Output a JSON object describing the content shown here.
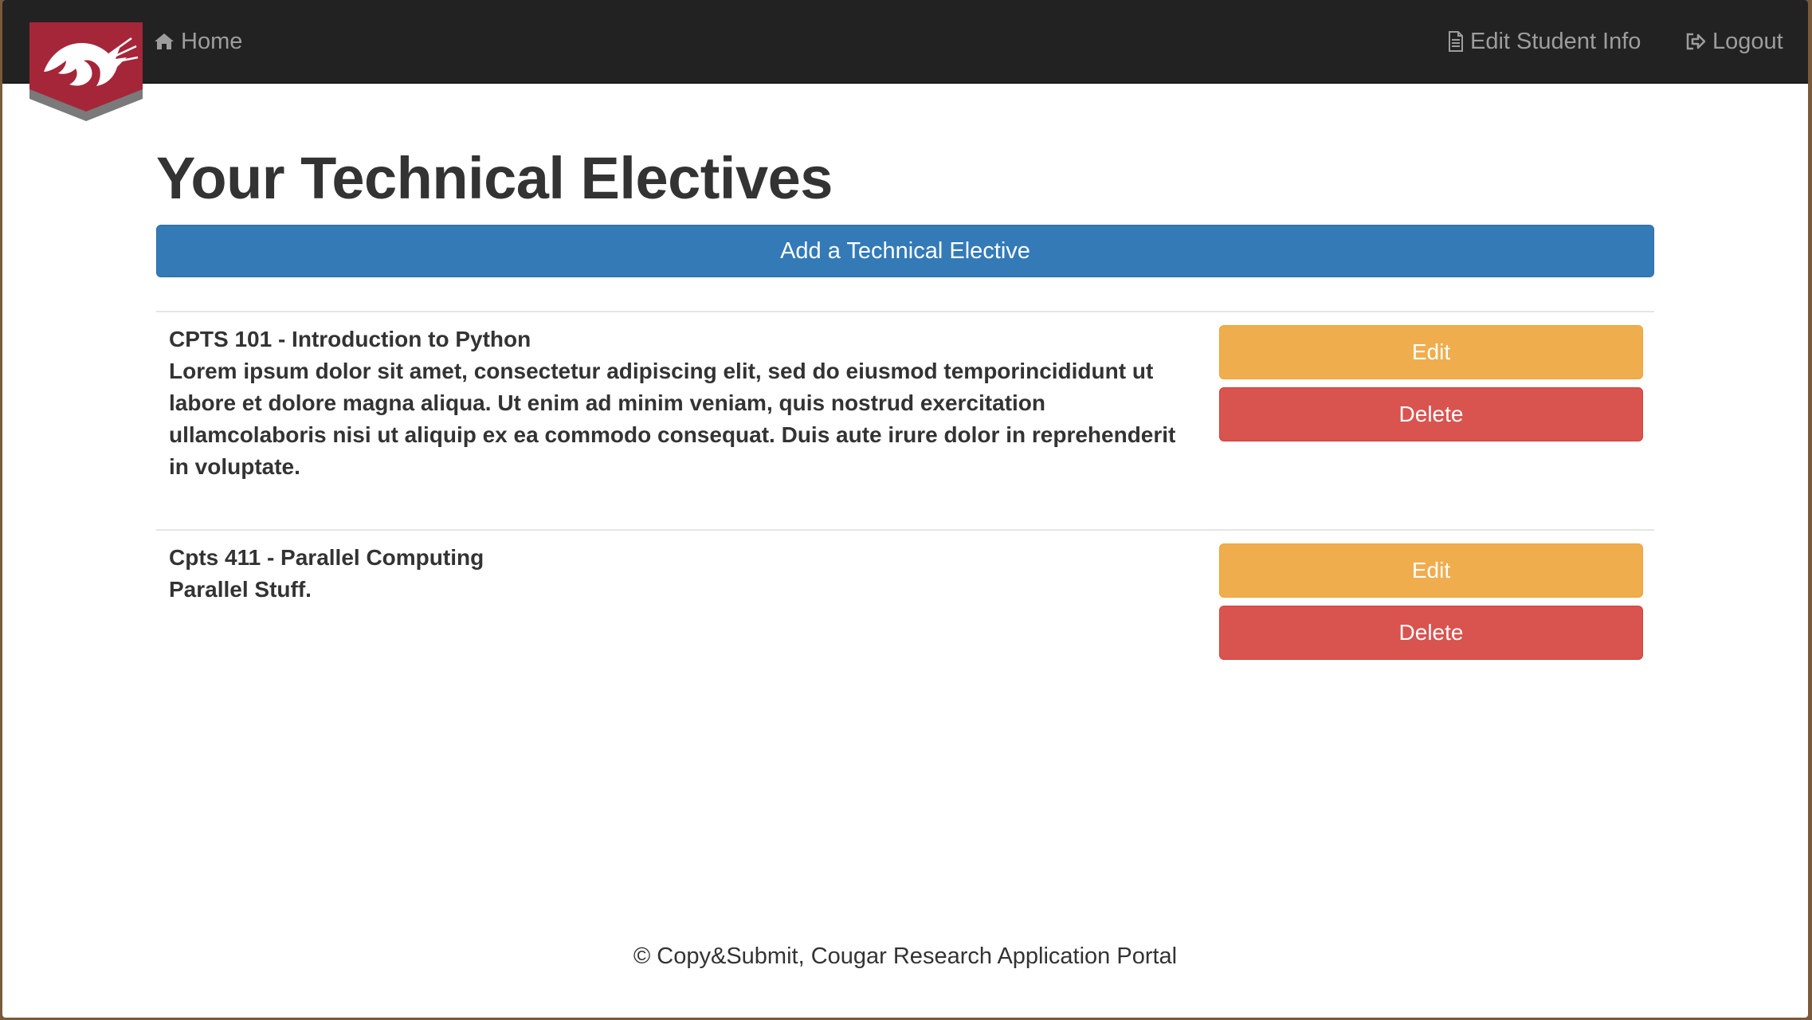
{
  "nav": {
    "home_label": "Home",
    "edit_label": "Edit Student Info",
    "logout_label": "Logout"
  },
  "page": {
    "title": "Your Technical Electives",
    "add_button": "Add a Technical Elective"
  },
  "electives": [
    {
      "title": "CPTS 101 - Introduction to Python",
      "description": "Lorem ipsum dolor sit amet, consectetur adipiscing elit, sed do eiusmod temporincididunt ut labore et dolore magna aliqua. Ut enim ad minim veniam, quis nostrud exercitation ullamcolaboris nisi ut aliquip ex ea commodo consequat. Duis aute irure dolor in reprehenderit in voluptate.",
      "edit_label": "Edit",
      "delete_label": "Delete"
    },
    {
      "title": "Cpts 411 - Parallel Computing",
      "description": "Parallel Stuff.",
      "edit_label": "Edit",
      "delete_label": "Delete"
    }
  ],
  "footer": {
    "text": "© Copy&Submit, Cougar Research Application Portal"
  },
  "colors": {
    "navbar": "#222222",
    "primary": "#337ab7",
    "warning": "#f0ad4e",
    "danger": "#d9534f",
    "logo_red": "#a62639",
    "logo_gray": "#7a7a7a"
  },
  "icons": {
    "logo": "wsu-cougar-shield-logo",
    "home": "home-icon",
    "edit": "document-icon",
    "logout": "logout-icon"
  }
}
